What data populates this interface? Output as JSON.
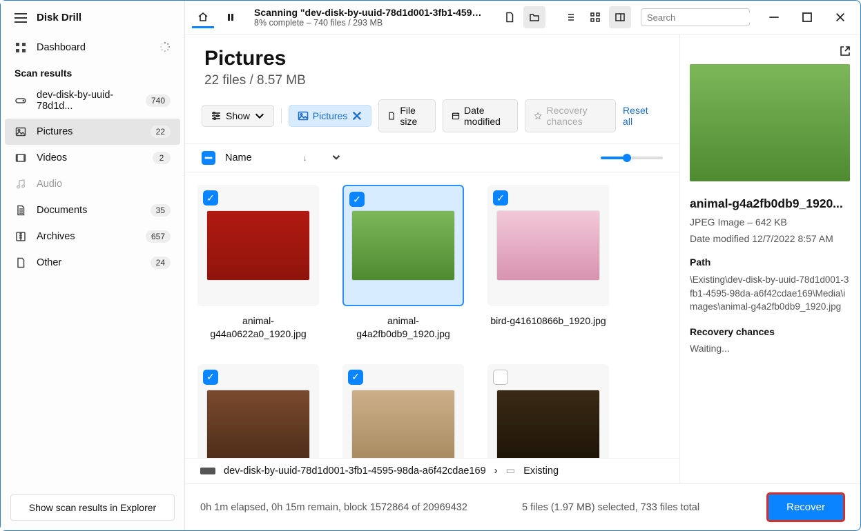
{
  "app": {
    "title": "Disk Drill"
  },
  "sidebar": {
    "dashboard": "Dashboard",
    "section": "Scan results",
    "disk": "dev-disk-by-uuid-78d1d...",
    "disk_count": "740",
    "items": [
      {
        "label": "Pictures",
        "count": "22"
      },
      {
        "label": "Videos",
        "count": "2"
      },
      {
        "label": "Audio",
        "count": ""
      },
      {
        "label": "Documents",
        "count": "35"
      },
      {
        "label": "Archives",
        "count": "657"
      },
      {
        "label": "Other",
        "count": "24"
      }
    ],
    "footer_btn": "Show scan results in Explorer"
  },
  "topbar": {
    "title": "Scanning \"dev-disk-by-uuid-78d1d001-3fb1-4595...",
    "subtitle": "8% complete – 740 files / 293 MB",
    "search_placeholder": "Search"
  },
  "page": {
    "title": "Pictures",
    "subtitle": "22 files / 8.57 MB"
  },
  "filters": {
    "show": "Show",
    "pictures": "Pictures",
    "filesize": "File size",
    "datemod": "Date modified",
    "recovery": "Recovery chances",
    "reset": "Reset all"
  },
  "cols": {
    "name": "Name"
  },
  "files": [
    {
      "name": "animal-g44a0622a0_1920.jpg",
      "checked": true,
      "sel": false,
      "th": "th-red"
    },
    {
      "name": "animal-g4a2fb0db9_1920.jpg",
      "checked": true,
      "sel": true,
      "th": "th-green"
    },
    {
      "name": "bird-g41610866b_1920.jpg",
      "checked": true,
      "sel": false,
      "th": "th-pink"
    },
    {
      "name": "",
      "checked": true,
      "sel": false,
      "th": "th-brown"
    },
    {
      "name": "",
      "checked": true,
      "sel": false,
      "th": "th-tan"
    },
    {
      "name": "",
      "checked": false,
      "sel": false,
      "th": "th-dark"
    }
  ],
  "details": {
    "title": "animal-g4a2fb0db9_1920...",
    "type": "JPEG Image – 642 KB",
    "modified": "Date modified 12/7/2022 8:57 AM",
    "path_h": "Path",
    "path": "\\Existing\\dev-disk-by-uuid-78d1d001-3fb1-4595-98da-a6f42cdae169\\Media\\images\\animal-g4a2fb0db9_1920.jpg",
    "rec_h": "Recovery chances",
    "rec": "Waiting..."
  },
  "breadcrumb": {
    "disk": "dev-disk-by-uuid-78d1d001-3fb1-4595-98da-a6f42cdae169",
    "folder": "Existing"
  },
  "bottom": {
    "status": "0h 1m elapsed, 0h 15m remain, block 1572864 of 20969432",
    "selection": "5 files (1.97 MB) selected, 733 files total",
    "recover": "Recover"
  }
}
